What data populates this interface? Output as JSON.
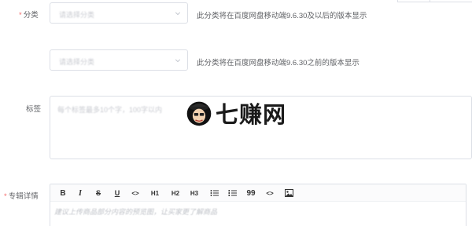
{
  "form": {
    "category": {
      "label": "分类",
      "required": true,
      "select_placeholder": "请选择分类",
      "hint": "此分类将在百度网盘移动端9.6.30及以后的版本显示"
    },
    "category_old": {
      "select_placeholder": "请选择分类",
      "hint": "此分类将在百度网盘移动端9.6.30之前的版本显示"
    },
    "tags": {
      "label": "标签",
      "placeholder": "每个标签最多10个字，100字以内"
    },
    "album_detail": {
      "label": "专辑详情",
      "required": true,
      "editor_placeholder": "建议上传商品部分内容的预览图，让买家更了解商品",
      "toolbar": {
        "bold": "B",
        "italic": "I",
        "strike": "S",
        "underline": "U",
        "code_inline": "<>",
        "h1": "H1",
        "h2": "H2",
        "h3": "H3",
        "quote": "99",
        "code_block": "<>"
      }
    }
  },
  "watermark": {
    "text": "七赚网",
    "icon": "mascot-logo-icon"
  },
  "colors": {
    "required_star": "#f56c6c",
    "border": "#dcdfe6",
    "label": "#606266",
    "placeholder": "#c0c4cc"
  }
}
